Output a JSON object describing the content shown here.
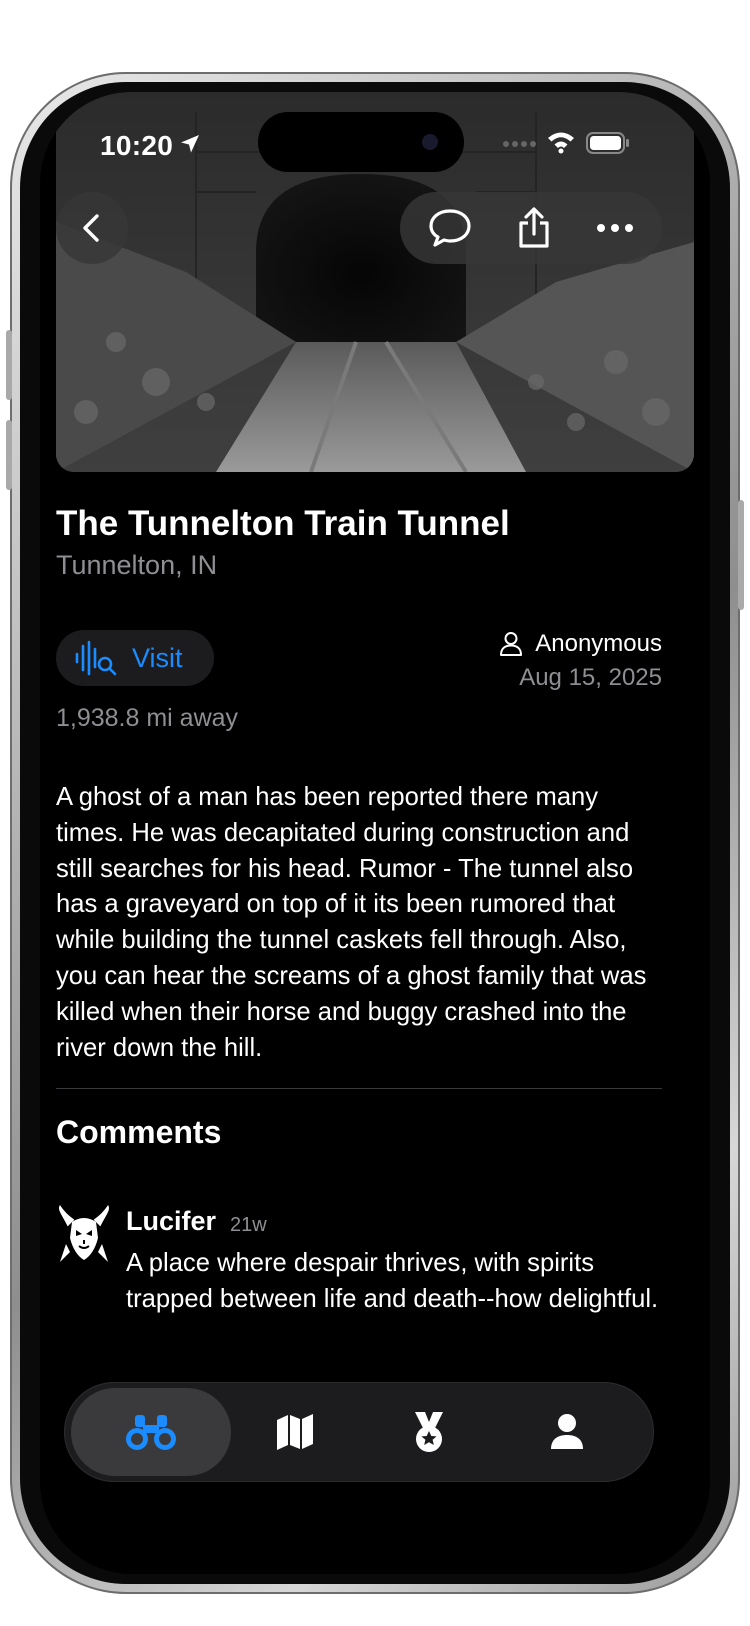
{
  "status_bar": {
    "time": "10:20"
  },
  "place": {
    "title": "The Tunnelton Train Tunnel",
    "location": "Tunnelton, IN",
    "visit_label": "Visit",
    "distance": "1,938.8 mi away",
    "author": "Anonymous",
    "date": "Aug 15, 2025",
    "description": "A ghost of a man has been reported there many times. He was decapitated during construction and still searches for his head. Rumor - The tunnel also has a graveyard on top of it its been rumored that while building the tunnel caskets fell through. Also, you can hear the screams of a ghost family that was killed when their horse and buggy crashed into the river down the hill."
  },
  "comments": {
    "heading": "Comments",
    "items": [
      {
        "user": "Lucifer",
        "age": "21w",
        "text": "A place where despair thrives, with spirits trapped between life and death--how delightful."
      }
    ]
  },
  "tabbar": {
    "items": [
      {
        "icon": "binoculars-icon",
        "active": true
      },
      {
        "icon": "map-icon",
        "active": false
      },
      {
        "icon": "medal-icon",
        "active": false
      },
      {
        "icon": "person-icon",
        "active": false
      }
    ]
  },
  "colors": {
    "accent": "#1a8cff",
    "background": "#000000",
    "secondary_text": "#8e8e93"
  }
}
